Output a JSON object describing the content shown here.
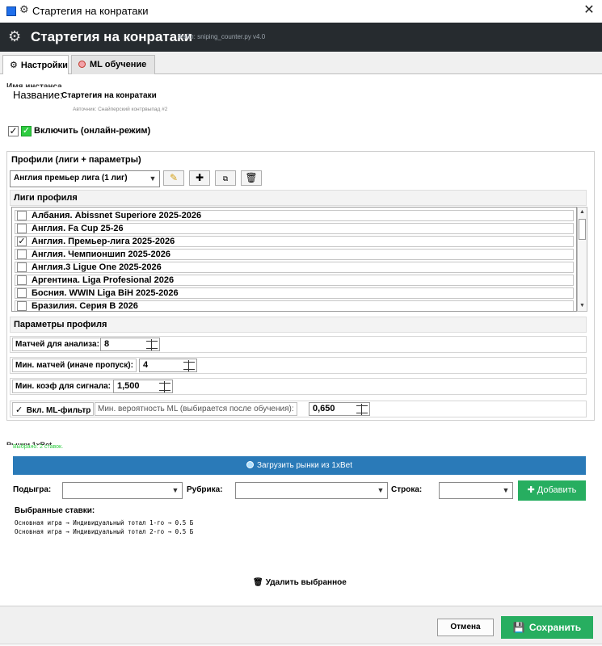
{
  "window": {
    "title": "Стартегия на конратаки",
    "close": "✕"
  },
  "header": {
    "title": "Стартегия на конратаки",
    "subtitle": "Файл: sniping_counter.py  v4.0"
  },
  "tabs": [
    {
      "label": "Настройки",
      "icon": "gear-icon"
    },
    {
      "label": "ML обучение",
      "icon": "brain-icon"
    }
  ],
  "strategy": {
    "name_caption": "Имя инстанса",
    "name_label": "Название:",
    "name_value": "Стартегия на конратаки",
    "author": "Авточник: Снайперский контрвыпад #2",
    "enable_label": "Включить (онлайн-режим)",
    "enabled": true
  },
  "profiles": {
    "title": "Профили  (лиги + параметры)",
    "selected_profile": "Англия премьер лига (1 лиг)",
    "leagues_header": "Лиги профиля",
    "leagues": [
      {
        "name": "Албания. Abissnet Superiore 2025-2026",
        "checked": false
      },
      {
        "name": "Англия. Fa Cup 25-26",
        "checked": false
      },
      {
        "name": "Англия. Премьер-лига 2025-2026",
        "checked": true
      },
      {
        "name": "Англия. Чемпионшип 2025-2026",
        "checked": false
      },
      {
        "name": "Англия.3 Ligue One 2025-2026",
        "checked": false
      },
      {
        "name": "Аргентина. Liga Profesional 2026",
        "checked": false
      },
      {
        "name": "Босния. WWIN Liga BiH 2025-2026",
        "checked": false
      },
      {
        "name": "Бразилия. Серия В 2026",
        "checked": false
      }
    ],
    "params_header": "Параметры профиля",
    "params": {
      "matches_label": "Матчей для анализа:",
      "matches_value": "8",
      "min_matches_label": "Мин. матчей (иначе пропуск):",
      "min_matches_value": "4",
      "min_coef_label": "Мин. коэф для сигнала:",
      "min_coef_value": "1,500",
      "ml_filter_label": "Вкл. ML-фильтр",
      "ml_filter_checked": true,
      "ml_prob_label": "Мин. вероятность ML (выбирается после обучения):",
      "ml_prob_value": "0,650"
    }
  },
  "markets": {
    "caption": "Рынки 1xBet",
    "selected_count": "Выбрано: 2 ставок.",
    "load_button": "Загрузить рынки из 1xBet",
    "subgame_label": "Подыгра:",
    "rubric_label": "Рубрика:",
    "row_label": "Строка:",
    "add_button": "Добавить",
    "selected_bets_caption": "Выбранные ставки:",
    "selected_bets": [
      "Основная игра → Индивидуальный тотал 1-го → 0.5 Б",
      "Основная игра → Индивидуальный тотал 2-го → 0.5 Б"
    ],
    "delete_button": "Удалить выбранное"
  },
  "footer": {
    "cancel": "Отмена",
    "save": "Сохранить"
  }
}
